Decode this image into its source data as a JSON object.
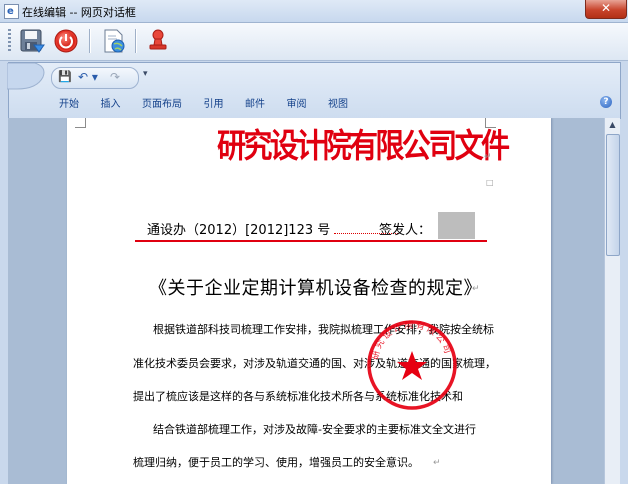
{
  "window": {
    "title": "在线编辑 -- 网页对话框",
    "close_glyph": "✕"
  },
  "toolbar": {
    "buttons": [
      {
        "name": "save-icon",
        "label": "保存"
      },
      {
        "name": "power-icon",
        "label": "关闭"
      },
      {
        "name": "document-globe-icon",
        "label": "文档"
      },
      {
        "name": "stamp-person-icon",
        "label": "盖章"
      }
    ]
  },
  "ribbon": {
    "qat": {
      "save": "💾",
      "undo": "↶ ▾",
      "redo": "↷",
      "more": "▾"
    },
    "tabs": [
      "开始",
      "插入",
      "页面布局",
      "引用",
      "邮件",
      "审阅",
      "视图"
    ],
    "help": "?"
  },
  "document": {
    "header": "研究设计院有限公司文件",
    "ref_prefix": "通设办（2012）[2012]123 号",
    "signer_label": "签发人：",
    "title": "《关于企业定期计算机设备检查的规定》",
    "paragraphs": [
      "根据铁道部科技司梳理工作安排，我院拟梳理工作安排，我院按全统标",
      "准化技术委员会要求，对涉及轨道交通的国、对涉及轨道交通的国家梳理，",
      "提出了梳应该是这样的各与系统标准化技术所各与系统标准化技术和",
      "结合铁道部梳理工作，对涉及故障-安全要求的主要标准文全文进行",
      "梳理归纳，便于员工的学习、使用，增强员工的安全意识。"
    ],
    "para_marks": [
      "",
      "",
      "",
      "",
      "↵"
    ],
    "stamp_text": "研究设计院有限公司"
  },
  "colors": {
    "header_red": "#e00010",
    "stamp_red": "#e60012"
  }
}
